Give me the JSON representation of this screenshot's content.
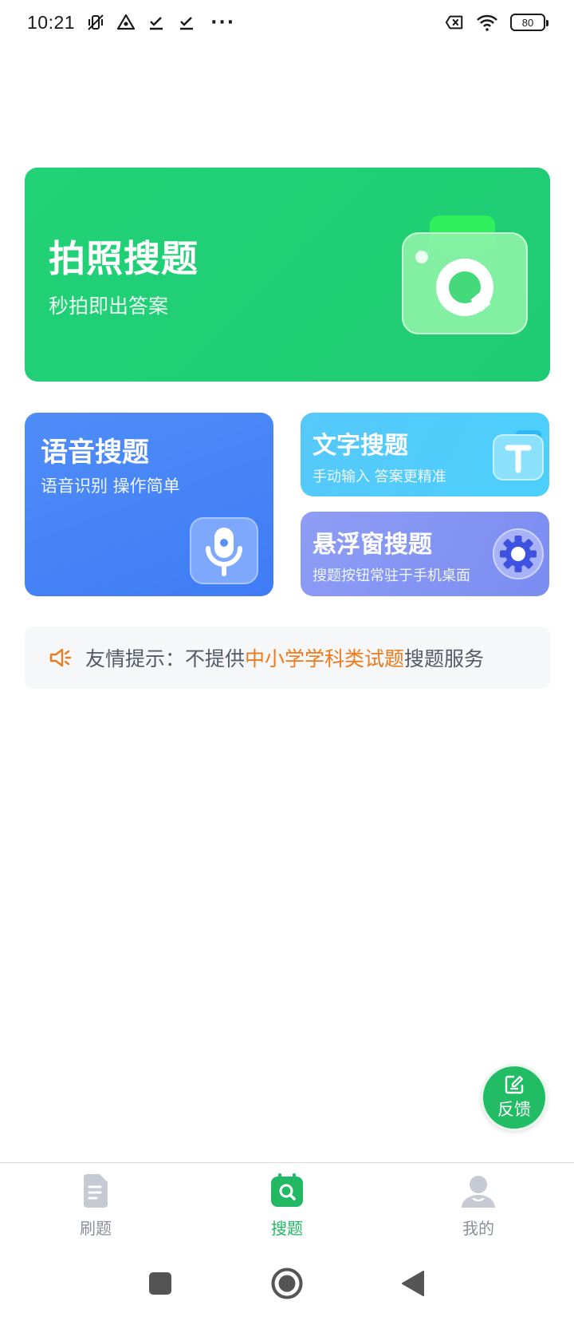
{
  "status_bar": {
    "time": "10:21",
    "more": "···",
    "battery": "80"
  },
  "cards": {
    "photo": {
      "title": "拍照搜题",
      "subtitle": "秒拍即出答案"
    },
    "voice": {
      "title": "语音搜题",
      "subtitle": "语音识别 操作简单"
    },
    "text": {
      "title": "文字搜题",
      "subtitle": "手动输入 答案更精准"
    },
    "float": {
      "title": "悬浮窗搜题",
      "subtitle": "搜题按钮常驻于手机桌面"
    }
  },
  "tip": {
    "prefix": "友情提示：不提供",
    "highlight": "中小学学科类试题",
    "suffix": "搜题服务"
  },
  "feedback": {
    "label": "反馈"
  },
  "bottom_nav": {
    "items": [
      {
        "label": "刷题"
      },
      {
        "label": "搜题"
      },
      {
        "label": "我的"
      }
    ],
    "active_index": 1
  },
  "colors": {
    "primary_green": "#22bc64",
    "photo_card": "#1fcb73",
    "voice_card": "#3f7cf6",
    "text_card": "#4ccffb",
    "float_card": "#7b8cf1",
    "tip_highlight": "#ef7a1a"
  }
}
